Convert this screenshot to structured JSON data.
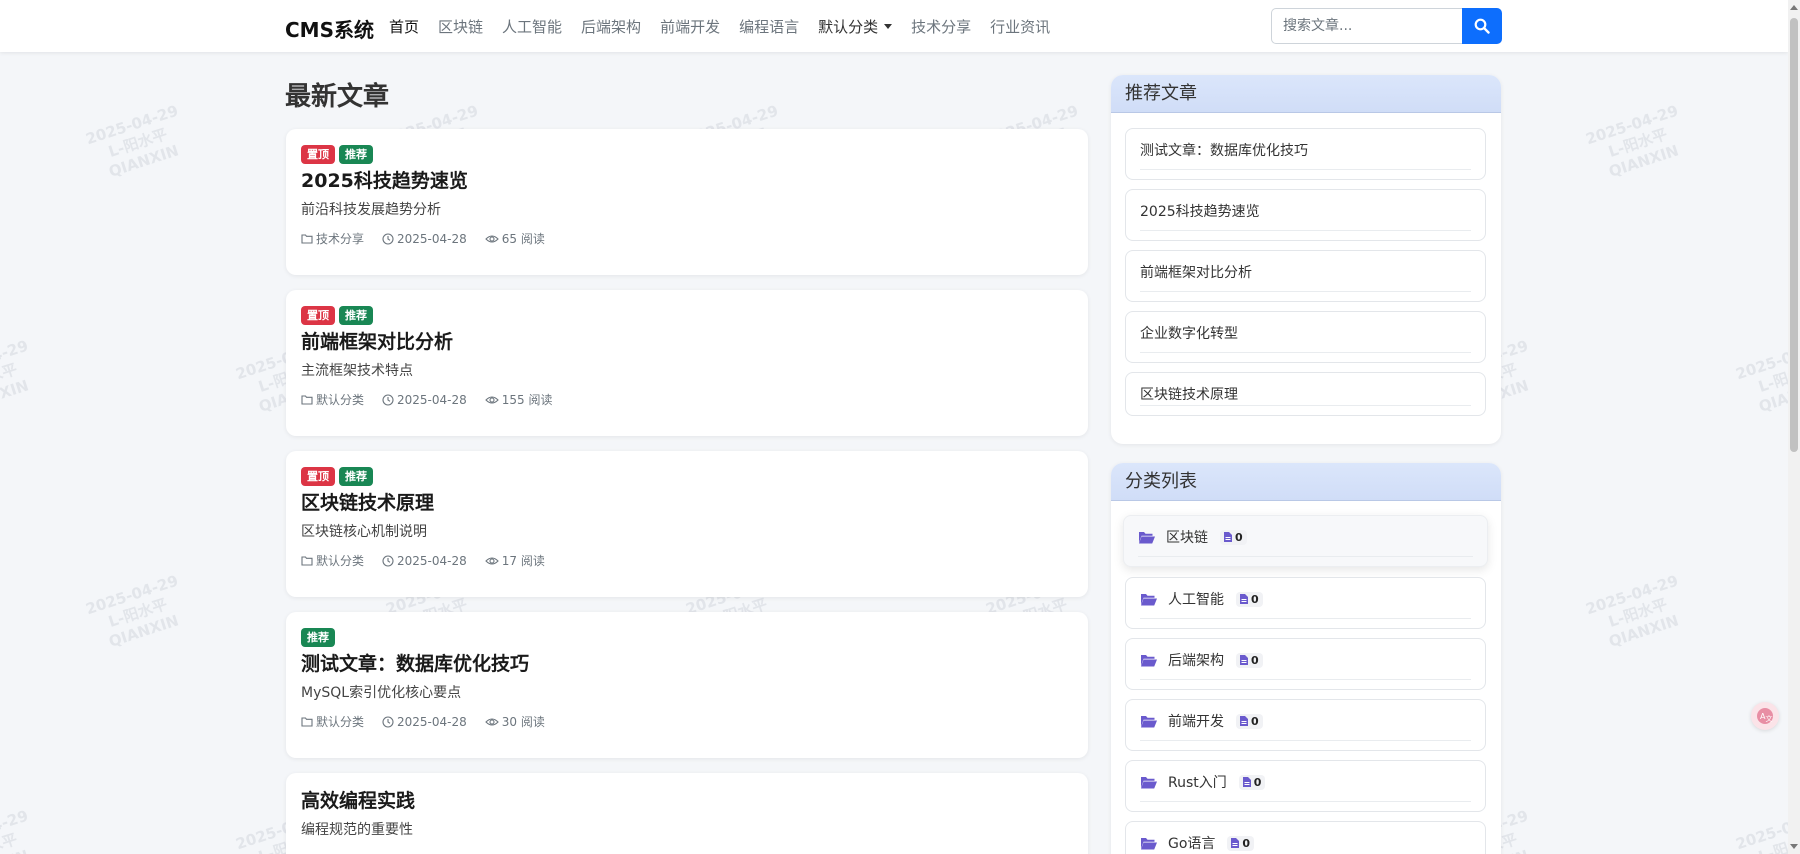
{
  "navbar": {
    "brand": "CMS系统",
    "links": [
      "首页",
      "区块链",
      "人工智能",
      "后端架构",
      "前端开发",
      "编程语言",
      "默认分类",
      "技术分享",
      "行业资讯"
    ],
    "search_placeholder": "搜索文章..."
  },
  "main": {
    "section_title": "最新文章",
    "articles": [
      {
        "badge_top": "置顶",
        "badge_rec": "推荐",
        "title": "2025科技趋势速览",
        "desc": "前沿科技发展趋势分析",
        "category": "技术分享",
        "date": "2025-04-28",
        "views": "65 阅读"
      },
      {
        "badge_top": "置顶",
        "badge_rec": "推荐",
        "title": "前端框架对比分析",
        "desc": "主流框架技术特点",
        "category": "默认分类",
        "date": "2025-04-28",
        "views": "155 阅读"
      },
      {
        "badge_top": "置顶",
        "badge_rec": "推荐",
        "title": "区块链技术原理",
        "desc": "区块链核心机制说明",
        "category": "默认分类",
        "date": "2025-04-28",
        "views": "17 阅读"
      },
      {
        "badge_rec": "推荐",
        "title": "测试文章：数据库优化技巧",
        "desc": "MySQL索引优化核心要点",
        "category": "默认分类",
        "date": "2025-04-28",
        "views": "30 阅读"
      },
      {
        "title": "高效编程实践",
        "desc": "编程规范的重要性"
      }
    ]
  },
  "sidebar": {
    "recommended_title": "推荐文章",
    "recommended": [
      "测试文章：数据库优化技巧",
      "2025科技趋势速览",
      "前端框架对比分析",
      "企业数字化转型",
      "区块链技术原理"
    ],
    "categories_title": "分类列表",
    "categories": [
      {
        "name": "区块链",
        "count": "0"
      },
      {
        "name": "人工智能",
        "count": "0"
      },
      {
        "name": "后端架构",
        "count": "0"
      },
      {
        "name": "前端开发",
        "count": "0"
      },
      {
        "name": "Rust入门",
        "count": "0"
      },
      {
        "name": "Go语言",
        "count": "0"
      }
    ]
  },
  "watermark": {
    "date": "2025-04-29",
    "line2": "L-阳水平",
    "line3": "QIANXIN"
  },
  "colors": {
    "primary": "#0d6efd",
    "badge_top": "#dc3545",
    "badge_rec": "#198754",
    "folder_icon": "#6a5acd"
  }
}
